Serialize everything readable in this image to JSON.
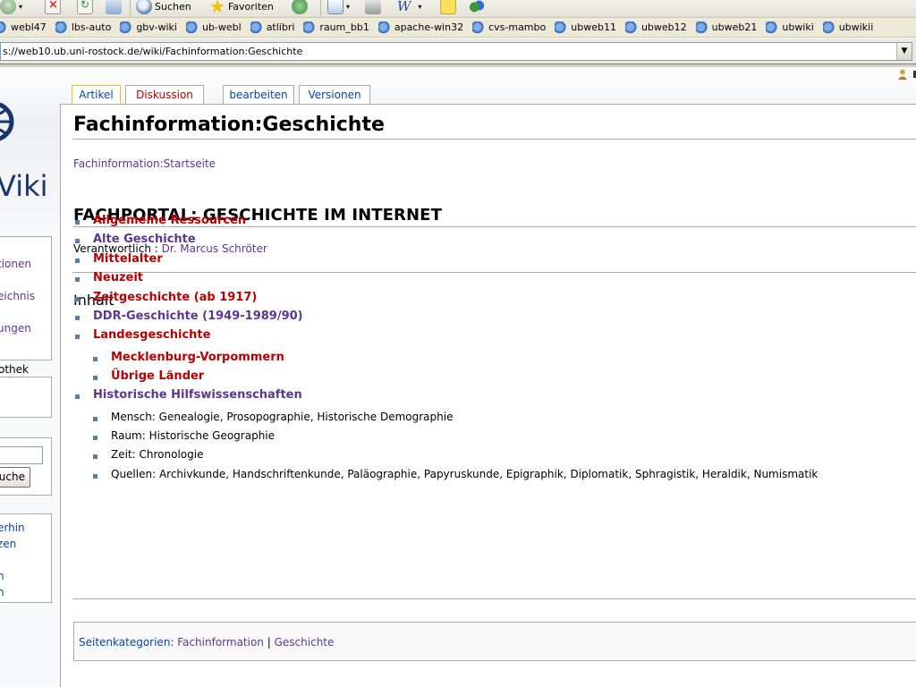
{
  "browser": {
    "toolbar": {
      "search_label": "Suchen",
      "favorites_label": "Favoriten"
    },
    "links": [
      "webl47",
      "lbs-auto",
      "gbv-wiki",
      "ub-webl",
      "atlibri",
      "raum_bb1",
      "apache-win32",
      "cvs-mambo",
      "ubweb11",
      "ubweb12",
      "ubweb21",
      "ubwiki",
      "ubwikii"
    ],
    "address": "s://web10.ub.uni-rostock.de/wiki/Fachinformation:Geschichte"
  },
  "sidebar": {
    "logo_text": "Viki",
    "nav_items": [
      "tionen",
      "eichnis",
      "ungen"
    ],
    "toolbox_label": "othek",
    "search_button": "uche",
    "tool_items": [
      "erhin",
      "zen",
      "n",
      "n"
    ]
  },
  "tabs": [
    {
      "label": "Artikel",
      "state": "selected"
    },
    {
      "label": "Diskussion",
      "state": "new"
    },
    {
      "label": "bearbeiten",
      "state": "normal"
    },
    {
      "label": "Versionen",
      "state": "normal"
    }
  ],
  "article": {
    "title": "Fachinformation:Geschichte",
    "subtitle_link": "Fachinformation:Startseite",
    "portal_heading": "FACHPORTAL: GESCHICHTE IM INTERNET",
    "responsible_label": "Verantwortlich :",
    "responsible_name": "Dr. Marcus Schröter",
    "toc_heading": "Inhalt",
    "toc": [
      {
        "label": "Allgemeine Ressourcen",
        "type": "red"
      },
      {
        "label": "Alte Geschichte",
        "type": "visited"
      },
      {
        "label": "Mittelalter",
        "type": "red"
      },
      {
        "label": "Neuzeit",
        "type": "red"
      },
      {
        "label": "Zeitgeschichte (ab 1917)",
        "type": "red"
      },
      {
        "label": "DDR-Geschichte (1949-1989/90)",
        "type": "visited"
      },
      {
        "label": "Landesgeschichte",
        "type": "red"
      }
    ],
    "landes_sub": [
      {
        "label": "Mecklenburg-Vorpommern",
        "type": "red"
      },
      {
        "label": "Übrige Länder",
        "type": "red"
      }
    ],
    "hilfs": {
      "label": "Historische Hilfswissenschaften",
      "type": "visited"
    },
    "hilfs_sub": [
      "Mensch: Genealogie, Prosopographie, Historische Demographie",
      "Raum: Historische Geographie",
      "Zeit: Chronologie",
      "Quellen: Archivkunde, Handschriftenkunde, Paläographie, Papyruskunde, Epigraphik, Diplomatik, Sphragistik, Heraldik, Numismatik"
    ],
    "categories_label": "Seitenkategorien:",
    "categories": [
      "Fachinformation",
      "Geschichte"
    ]
  },
  "colors": {
    "red_link": "#ba0000",
    "visited_link": "#5a3696",
    "link": "#0645ad",
    "bullet": "#5a7ea6",
    "selected_tab_border": "#fabd23"
  }
}
